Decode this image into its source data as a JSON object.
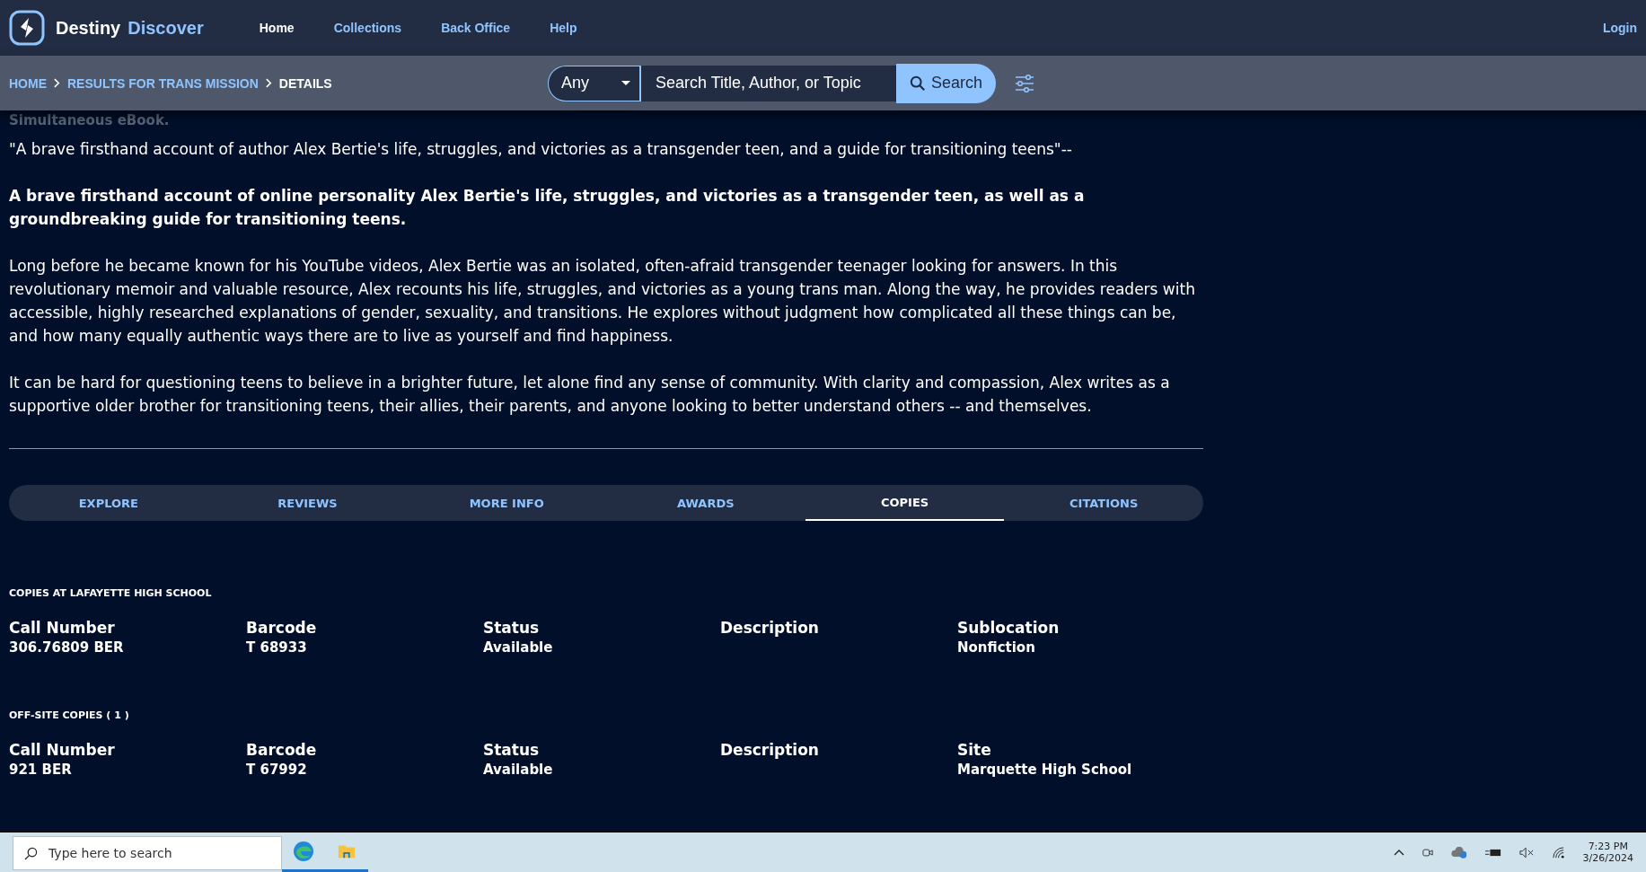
{
  "header": {
    "brand": {
      "name": "Destiny",
      "product": "Discover"
    },
    "nav": [
      {
        "label": "Home",
        "selected": true
      },
      {
        "label": "Collections",
        "selected": false
      },
      {
        "label": "Back Office",
        "selected": false
      },
      {
        "label": "Help",
        "selected": false
      }
    ],
    "login": "Login"
  },
  "breadcrumb": [
    {
      "label": "HOME",
      "current": false
    },
    {
      "label": "RESULTS FOR TRANS MISSION",
      "current": false
    },
    {
      "label": "DETAILS",
      "current": true
    }
  ],
  "search": {
    "scope": "Any",
    "placeholder": "Search Title, Author, or Topic",
    "button": "Search"
  },
  "faded_text": "Simultaneous eBook.",
  "paragraphs": [
    "\"A brave firsthand account of author Alex Bertie's life, struggles, and victories as a transgender teen, and a guide for transitioning teens\"--",
    "A brave firsthand account of online personality Alex Bertie's life, struggles, and victories as a transgender teen, as well as a groundbreaking guide for transitioning teens.",
    "Long before he became known for his YouTube videos, Alex Bertie was an isolated, often-afraid transgender teenager looking for answers. In this revolutionary memoir and valuable resource, Alex recounts his life, struggles, and victories as a young trans man. Along the way, he provides readers with accessible, highly researched explanations of gender, sexuality, and transitions. He explores without judgment how complicated all these things can be, and how many equally authentic ways there are to live as yourself and find happiness.",
    "It can be hard for questioning teens to believe in a brighter future, let alone find any sense of community. With clarity and compassion, Alex writes as a supportive older brother for transitioning teens, their allies, their parents, and anyone looking to better understand others -- and themselves."
  ],
  "tabs": [
    {
      "label": "EXPLORE",
      "selected": false
    },
    {
      "label": "REVIEWS",
      "selected": false
    },
    {
      "label": "MORE INFO",
      "selected": false
    },
    {
      "label": "AWARDS",
      "selected": false
    },
    {
      "label": "COPIES",
      "selected": true
    },
    {
      "label": "CITATIONS",
      "selected": false
    }
  ],
  "copy_sections": [
    {
      "title": "COPIES AT LAFAYETTE HIGH SCHOOL",
      "columns": [
        "Call Number",
        "Barcode",
        "Status",
        "Description",
        "Sublocation"
      ],
      "rows": [
        [
          "306.76809 BER",
          "T 68933",
          "Available",
          "",
          "Nonfiction"
        ]
      ]
    },
    {
      "title": "OFF-SITE COPIES ( 1 )",
      "columns": [
        "Call Number",
        "Barcode",
        "Status",
        "Description",
        "Site"
      ],
      "rows": [
        [
          "921 BER",
          "T 67992",
          "Available",
          "",
          "Marquette High School"
        ]
      ]
    }
  ],
  "taskbar": {
    "search_placeholder": "Type here to search",
    "time": "7:23 PM",
    "date": "3/26/2024"
  }
}
